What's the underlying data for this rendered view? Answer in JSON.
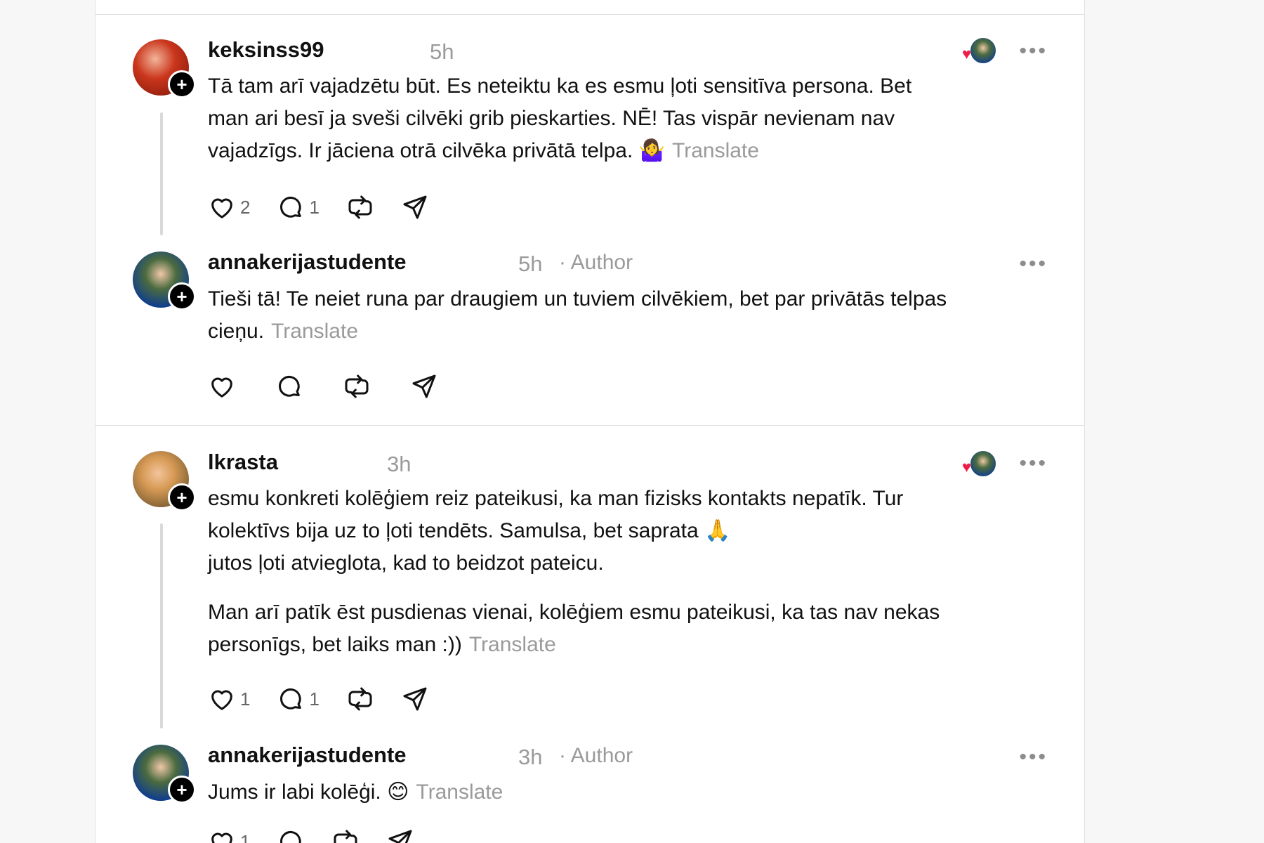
{
  "posts": [
    {
      "username": "keksinss99",
      "time": "5h",
      "author_label": "",
      "text": [
        "Tā tam arī vajadzētu būt. Es neteiktu ka es esmu ļoti sensitīva persona. Bet man ari besī ja sveši cilvēki grib pieskarties. NĒ! Tas vispār nevienam nav vajadzīgs. Ir jāciena otrā cilvēka privātā telpa."
      ],
      "emoji": "🤷‍♀️",
      "translate": "Translate",
      "likes": "2",
      "replies": "1",
      "liked_by_author": true
    },
    {
      "username": "annakerijastudente",
      "time": "5h",
      "author_label": "· Author",
      "text": [
        "Tieši tā! Te neiet runa par draugiem un tuviem cilvēkiem, bet par privātās telpas cieņu."
      ],
      "translate": "Translate",
      "likes": "",
      "replies": ""
    },
    {
      "username": "lkrasta",
      "time": "3h",
      "author_label": "",
      "text": [
        "esmu konkreti kolēģiem reiz pateikusi, ka man fizisks kontakts nepatīk. Tur kolektīvs bija uz to ļoti tendēts. Samulsa, bet saprata",
        "jutos ļoti atvieglota, kad to beidzot pateicu.",
        "Man arī patīk ēst pusdienas vienai, kolēģiem esmu pateikusi, ka tas nav nekas personīgs, bet laiks man :))"
      ],
      "emoji": "🙏",
      "translate": "Translate",
      "likes": "1",
      "replies": "1",
      "liked_by_author": true
    },
    {
      "username": "annakerijastudente",
      "time": "3h",
      "author_label": "· Author",
      "text": [
        "Jums ir labi kolēģi."
      ],
      "emoji": "😊",
      "translate": "Translate",
      "likes": "1",
      "replies": ""
    }
  ],
  "icons": {
    "like": "heart-icon",
    "reply": "comment-icon",
    "repost": "repost-icon",
    "share": "send-icon",
    "more": "more-options-icon",
    "follow": "plus-icon"
  },
  "colors": {
    "liked_heart": "#ee1e49",
    "muted_text": "#9a9a9a"
  }
}
